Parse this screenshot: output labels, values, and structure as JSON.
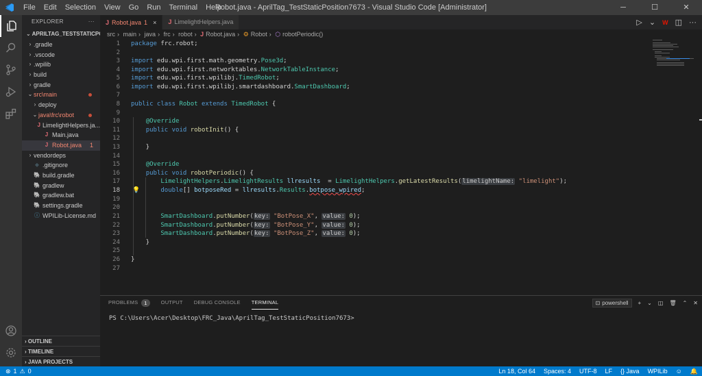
{
  "window": {
    "title": "Robot.java - AprilTag_TestStaticPosition7673 - Visual Studio Code [Administrator]",
    "menu": [
      "File",
      "Edit",
      "Selection",
      "View",
      "Go",
      "Run",
      "Terminal",
      "Help"
    ]
  },
  "sidebar": {
    "header": "EXPLORER",
    "more": "···",
    "project": "APRILTAG_TESTSTATICPOS...",
    "items": [
      {
        "label": ".gradle",
        "indent": 1,
        "type": "folder"
      },
      {
        "label": ".vscode",
        "indent": 1,
        "type": "folder"
      },
      {
        "label": ".wpilib",
        "indent": 1,
        "type": "folder"
      },
      {
        "label": "build",
        "indent": 1,
        "type": "folder"
      },
      {
        "label": "gradle",
        "indent": 1,
        "type": "folder"
      },
      {
        "label": "src\\main",
        "indent": 1,
        "type": "folder-open",
        "modified": true
      },
      {
        "label": "deploy",
        "indent": 2,
        "type": "folder"
      },
      {
        "label": "java\\frc\\robot",
        "indent": 2,
        "type": "folder-open",
        "modified": true
      },
      {
        "label": "LimelightHelpers.ja...",
        "indent": 3,
        "type": "java"
      },
      {
        "label": "Main.java",
        "indent": 3,
        "type": "java"
      },
      {
        "label": "Robot.java",
        "indent": 3,
        "type": "java",
        "selected": true,
        "badge": "1"
      },
      {
        "label": "vendordeps",
        "indent": 1,
        "type": "folder"
      },
      {
        "label": ".gitignore",
        "indent": 1,
        "type": "git"
      },
      {
        "label": "build.gradle",
        "indent": 1,
        "type": "gradle"
      },
      {
        "label": "gradlew",
        "indent": 1,
        "type": "gradle"
      },
      {
        "label": "gradlew.bat",
        "indent": 1,
        "type": "gradle"
      },
      {
        "label": "settings.gradle",
        "indent": 1,
        "type": "gradle"
      },
      {
        "label": "WPILib-License.md",
        "indent": 1,
        "type": "md"
      }
    ],
    "sections": [
      "OUTLINE",
      "TIMELINE",
      "JAVA PROJECTS"
    ]
  },
  "tabs": [
    {
      "label": "Robot.java",
      "badge": "1",
      "close": "×",
      "active": true
    },
    {
      "label": "LimelightHelpers.java",
      "active": false
    }
  ],
  "breadcrumb": [
    "src",
    "main",
    "java",
    "frc",
    "robot",
    "Robot.java",
    "Robot",
    "robotPeriodic()"
  ],
  "panel": {
    "tabs": [
      "PROBLEMS",
      "OUTPUT",
      "DEBUG CONSOLE",
      "TERMINAL"
    ],
    "problems_count": "1",
    "shell": "powershell",
    "prompt": "PS C:\\Users\\Acer\\Desktop\\FRC_Java\\AprilTag_TestStaticPosition7673>"
  },
  "status": {
    "errors": "1",
    "warnings": "0",
    "position": "Ln 18, Col 64",
    "spaces": "Spaces: 4",
    "encoding": "UTF-8",
    "eol": "LF",
    "language": "Java",
    "extension": "WPILib"
  },
  "colors": {
    "accent": "#007acc",
    "error": "#f48771",
    "background": "#1e1e1e"
  }
}
